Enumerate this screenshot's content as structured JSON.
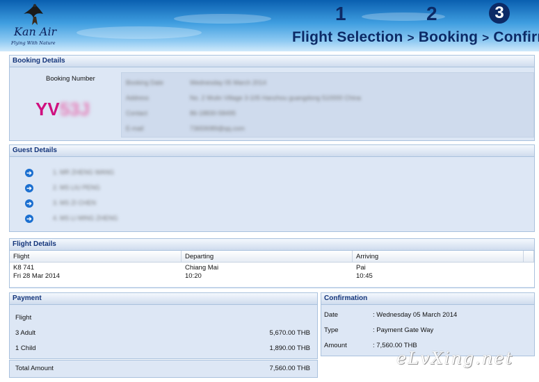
{
  "header": {
    "logo_name": "Kan Air",
    "logo_tagline": "Flying With Nature",
    "step1_num": "1",
    "step2_num": "2",
    "step3_num": "3",
    "step1_label": "Flight Selection",
    "step2_label": "Booking",
    "step3_label": "Confirm",
    "separator": ">"
  },
  "booking": {
    "title": "Booking Details",
    "number_label": "Booking Number",
    "number_visible": "YV",
    "number_hidden": "53J",
    "contact_rows": [
      {
        "key": "Booking Date",
        "value": "Wednesday 05 March 2014"
      },
      {
        "key": "Address",
        "value": "No. 2 Wulin Village 3-105 Hanzhou guangdong 510000 China"
      },
      {
        "key": "Contact",
        "value": "86-18830-58495"
      },
      {
        "key": "E-mail",
        "value": "73659089@qq.com"
      }
    ]
  },
  "guests": {
    "title": "Guest Details",
    "items": [
      {
        "icon": "arrow-circle-right-icon",
        "name": "1. MR ZHENG WANG"
      },
      {
        "icon": "arrow-circle-right-icon",
        "name": "2. MS LIU PENG"
      },
      {
        "icon": "arrow-circle-right-icon",
        "name": "3. MS ZI CHEN"
      },
      {
        "icon": "arrow-circle-right-icon",
        "name": "4. MS LI MING ZHENG"
      }
    ]
  },
  "flight": {
    "title": "Flight Details",
    "columns": [
      "Flight",
      "Departing",
      "Arriving"
    ],
    "row": {
      "flight_no": "K8 741",
      "flight_date": "Fri 28 Mar 2014",
      "dep_city": "Chiang Mai",
      "dep_time": "10:20",
      "arr_city": "Pai",
      "arr_time": "10:45"
    }
  },
  "payment": {
    "title": "Payment",
    "section": "Flight",
    "lines": [
      {
        "label": "3 Adult",
        "amount": "5,670.00 THB"
      },
      {
        "label": "1 Child",
        "amount": "1,890.00 THB"
      }
    ],
    "total_label": "Total Amount",
    "total_amount": "7,560.00 THB"
  },
  "confirmation": {
    "title": "Confirmation",
    "rows": [
      {
        "label": "Date",
        "value": ": Wednesday 05 March 2014"
      },
      {
        "label": "Type",
        "value": ": Payment Gate Way"
      },
      {
        "label": "Amount",
        "value": ": 7,560.00 THB"
      }
    ]
  },
  "watermark": "eLvXing.net",
  "colors": {
    "brand_navy": "#0c2a66",
    "panel_bg": "#dde7f5",
    "booking_code": "#cf0f7f",
    "link_icon": "#1b6fd0"
  }
}
